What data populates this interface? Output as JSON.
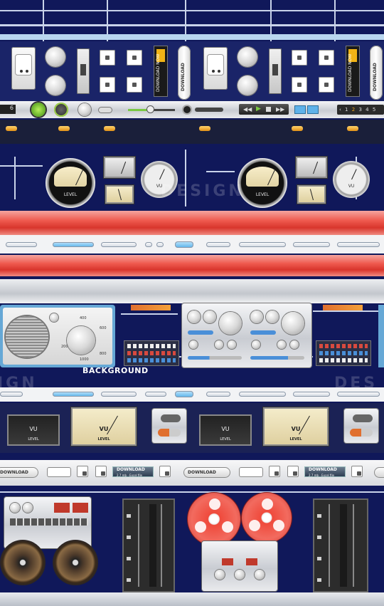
{
  "top_strip": {
    "download_now_label": "DOWNLOAD NOW",
    "download_label": "DOWNLOAD"
  },
  "media_bar": {
    "left_counter": "6",
    "pagination": [
      "1",
      "2",
      "3",
      "4",
      "5"
    ]
  },
  "vu_row_1": {
    "level_label": "LEVEL",
    "vu_label": "VU"
  },
  "radio": {
    "dial_numbers": [
      "400",
      "600",
      "800",
      "200",
      "1000"
    ]
  },
  "background_caption": "BACKGROUND",
  "vu_row_2": {
    "vu_label": "VU",
    "level_label": "LEVEL"
  },
  "download_row": {
    "pill_label": "DOWNLOAD",
    "blue_label": "DOWNLOAD",
    "blue_sub": "2.7 mb - Excel file"
  },
  "watermarks": [
    "IGN",
    "DESIGN",
    "DES"
  ],
  "colors": {
    "pcb": "#10185a",
    "trace": "#c9d3ea",
    "red_tube": "#e8463c",
    "accent_orange": "#f2a51a",
    "accent_blue": "#58b2ea"
  }
}
